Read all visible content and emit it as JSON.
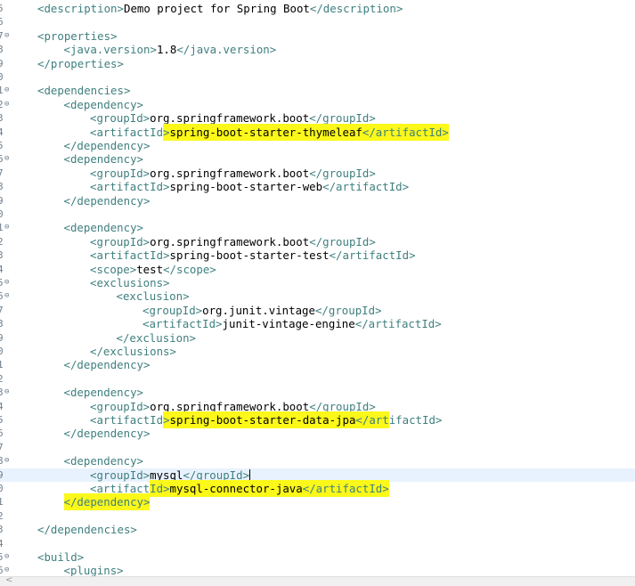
{
  "editor": {
    "current_line_index": 34,
    "highlight_color": "#fbf81a",
    "lines": [
      {
        "ln": "5",
        "fold": "",
        "indent": 0,
        "parts": [
          {
            "t": "tag",
            "v": "<description>"
          },
          {
            "t": "txt",
            "v": "Demo project for Spring Boot"
          },
          {
            "t": "tag",
            "v": "</description>"
          }
        ]
      },
      {
        "ln": "6",
        "fold": "",
        "indent": 0,
        "parts": []
      },
      {
        "ln": "7",
        "fold": "⊖",
        "indent": 0,
        "parts": [
          {
            "t": "tag",
            "v": "<properties>"
          }
        ]
      },
      {
        "ln": "8",
        "fold": "",
        "indent": 1,
        "parts": [
          {
            "t": "tag",
            "v": "<java.version>"
          },
          {
            "t": "txt",
            "v": "1.8"
          },
          {
            "t": "tag",
            "v": "</java.version>"
          }
        ]
      },
      {
        "ln": "9",
        "fold": "",
        "indent": 0,
        "parts": [
          {
            "t": "tag",
            "v": "</properties>"
          }
        ]
      },
      {
        "ln": "0",
        "fold": "",
        "indent": 0,
        "parts": []
      },
      {
        "ln": "1",
        "fold": "⊖",
        "indent": 0,
        "parts": [
          {
            "t": "tag",
            "v": "<dependencies>"
          }
        ]
      },
      {
        "ln": "2",
        "fold": "⊖",
        "indent": 1,
        "parts": [
          {
            "t": "tag",
            "v": "<dependency>"
          }
        ]
      },
      {
        "ln": "3",
        "fold": "",
        "indent": 2,
        "parts": [
          {
            "t": "tag",
            "v": "<groupId>"
          },
          {
            "t": "txt",
            "v": "org.springframework.boot"
          },
          {
            "t": "tag",
            "v": "</groupId>"
          }
        ]
      },
      {
        "ln": "4",
        "fold": "",
        "indent": 2,
        "parts": [
          {
            "t": "tag",
            "v": "<artifactId"
          },
          {
            "t": "tag",
            "v": ">",
            "hl": true
          },
          {
            "t": "txt",
            "v": "spring-boot-starter-thymeleaf",
            "hl": true
          },
          {
            "t": "tag",
            "v": "</artifactId>",
            "hl": true
          }
        ]
      },
      {
        "ln": "5",
        "fold": "",
        "indent": 1,
        "parts": [
          {
            "t": "tag",
            "v": "</dependency>"
          }
        ]
      },
      {
        "ln": "6",
        "fold": "⊖",
        "indent": 1,
        "parts": [
          {
            "t": "tag",
            "v": "<dependency>"
          }
        ]
      },
      {
        "ln": "7",
        "fold": "",
        "indent": 2,
        "parts": [
          {
            "t": "tag",
            "v": "<groupId>"
          },
          {
            "t": "txt",
            "v": "org.springframework.boot"
          },
          {
            "t": "tag",
            "v": "</groupId>"
          }
        ]
      },
      {
        "ln": "8",
        "fold": "",
        "indent": 2,
        "parts": [
          {
            "t": "tag",
            "v": "<artifactId>"
          },
          {
            "t": "txt",
            "v": "spring-boot-starter-web"
          },
          {
            "t": "tag",
            "v": "</artifactId>"
          }
        ]
      },
      {
        "ln": "9",
        "fold": "",
        "indent": 1,
        "parts": [
          {
            "t": "tag",
            "v": "</dependency>"
          }
        ]
      },
      {
        "ln": "0",
        "fold": "",
        "indent": 0,
        "parts": []
      },
      {
        "ln": "1",
        "fold": "⊖",
        "indent": 1,
        "parts": [
          {
            "t": "tag",
            "v": "<dependency>"
          }
        ]
      },
      {
        "ln": "2",
        "fold": "",
        "indent": 2,
        "parts": [
          {
            "t": "tag",
            "v": "<groupId>"
          },
          {
            "t": "txt",
            "v": "org.springframework.boot"
          },
          {
            "t": "tag",
            "v": "</groupId>"
          }
        ]
      },
      {
        "ln": "3",
        "fold": "",
        "indent": 2,
        "parts": [
          {
            "t": "tag",
            "v": "<artifactId>"
          },
          {
            "t": "txt",
            "v": "spring-boot-starter-test"
          },
          {
            "t": "tag",
            "v": "</artifactId>"
          }
        ]
      },
      {
        "ln": "4",
        "fold": "",
        "indent": 2,
        "parts": [
          {
            "t": "tag",
            "v": "<scope>"
          },
          {
            "t": "txt",
            "v": "test"
          },
          {
            "t": "tag",
            "v": "</scope>"
          }
        ]
      },
      {
        "ln": "5",
        "fold": "⊖",
        "indent": 2,
        "parts": [
          {
            "t": "tag",
            "v": "<exclusions>"
          }
        ]
      },
      {
        "ln": "6",
        "fold": "⊖",
        "indent": 3,
        "parts": [
          {
            "t": "tag",
            "v": "<exclusion>"
          }
        ]
      },
      {
        "ln": "7",
        "fold": "",
        "indent": 4,
        "parts": [
          {
            "t": "tag",
            "v": "<groupId>"
          },
          {
            "t": "txt",
            "v": "org.junit.vintage"
          },
          {
            "t": "tag",
            "v": "</groupId>"
          }
        ]
      },
      {
        "ln": "8",
        "fold": "",
        "indent": 4,
        "parts": [
          {
            "t": "tag",
            "v": "<artifactId>"
          },
          {
            "t": "txt",
            "v": "junit-vintage-engine"
          },
          {
            "t": "tag",
            "v": "</artifactId>"
          }
        ]
      },
      {
        "ln": "9",
        "fold": "",
        "indent": 3,
        "parts": [
          {
            "t": "tag",
            "v": "</exclusion>"
          }
        ]
      },
      {
        "ln": "0",
        "fold": "",
        "indent": 2,
        "parts": [
          {
            "t": "tag",
            "v": "</exclusions>"
          }
        ]
      },
      {
        "ln": "1",
        "fold": "",
        "indent": 1,
        "parts": [
          {
            "t": "tag",
            "v": "</dependency>"
          }
        ]
      },
      {
        "ln": "2",
        "fold": "",
        "indent": 0,
        "parts": []
      },
      {
        "ln": "3",
        "fold": "⊖",
        "indent": 1,
        "parts": [
          {
            "t": "tag",
            "v": "<dependency>"
          }
        ]
      },
      {
        "ln": "4",
        "fold": "",
        "indent": 2,
        "parts": [
          {
            "t": "tag",
            "v": "<groupId>"
          },
          {
            "t": "txt",
            "v": "org.springframework.boot"
          },
          {
            "t": "tag",
            "v": "</groupId>"
          }
        ]
      },
      {
        "ln": "5",
        "fold": "",
        "indent": 2,
        "parts": [
          {
            "t": "tag",
            "v": "<artifactId"
          },
          {
            "t": "tag",
            "v": ">",
            "hl": true
          },
          {
            "t": "txt",
            "v": "spring-boot-starter-data-jpa",
            "hl": true
          },
          {
            "t": "tag",
            "v": "</art",
            "hl": true
          },
          {
            "t": "tag",
            "v": "ifactId>"
          }
        ]
      },
      {
        "ln": "6",
        "fold": "",
        "indent": 1,
        "parts": [
          {
            "t": "tag",
            "v": "</dependency>"
          }
        ]
      },
      {
        "ln": "7",
        "fold": "",
        "indent": 0,
        "parts": []
      },
      {
        "ln": "8",
        "fold": "⊖",
        "indent": 1,
        "parts": [
          {
            "t": "tag",
            "v": "<dependency>"
          }
        ]
      },
      {
        "ln": "9",
        "fold": "",
        "indent": 2,
        "cursor": true,
        "parts": [
          {
            "t": "tag",
            "v": "<groupId>"
          },
          {
            "t": "txt",
            "v": "mysql"
          },
          {
            "t": "tag",
            "v": "</groupId>"
          }
        ]
      },
      {
        "ln": "0",
        "fold": "",
        "indent": 2,
        "parts": [
          {
            "t": "tag",
            "v": "<artifact"
          },
          {
            "t": "tag",
            "v": "Id>",
            "hl": true
          },
          {
            "t": "txt",
            "v": "mysql-connector-java",
            "hl": true
          },
          {
            "t": "tag",
            "v": "</artifactId>",
            "hl": true
          }
        ]
      },
      {
        "ln": "1",
        "fold": "",
        "indent": 1,
        "parts": [
          {
            "t": "tag",
            "v": "</dependency>",
            "hl": true
          }
        ]
      },
      {
        "ln": "2",
        "fold": "",
        "indent": 0,
        "parts": []
      },
      {
        "ln": "3",
        "fold": "",
        "indent": 0,
        "parts": [
          {
            "t": "tag",
            "v": "</dependencies>"
          }
        ]
      },
      {
        "ln": "4",
        "fold": "",
        "indent": 0,
        "parts": []
      },
      {
        "ln": "5",
        "fold": "⊖",
        "indent": 0,
        "parts": [
          {
            "t": "tag",
            "v": "<build>"
          }
        ]
      },
      {
        "ln": "6",
        "fold": "⊖",
        "indent": 1,
        "parts": [
          {
            "t": "tag",
            "v": "<plugins>"
          }
        ]
      }
    ]
  },
  "scrollbar": {
    "left_arrow_icon": "chevron-left-icon",
    "arrow_glyph": "<"
  }
}
